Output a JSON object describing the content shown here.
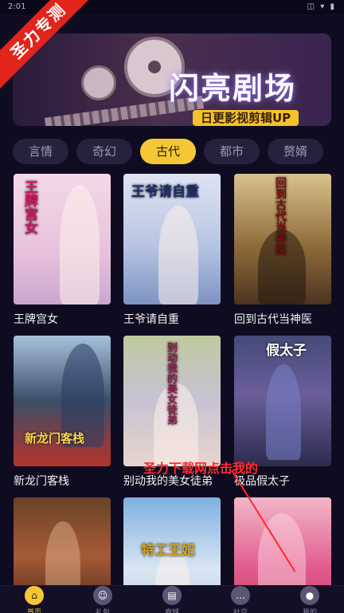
{
  "status_bar": {
    "time": "2:01",
    "icons": "◫ ▾ ▮"
  },
  "watermark": {
    "ribbon": "圣力专测",
    "overlay": "圣力下载网点击我的"
  },
  "banner": {
    "title": "闪亮剧场",
    "subtitle": "日更影视剪辑UP"
  },
  "tabs": [
    {
      "label": "言情",
      "active": false
    },
    {
      "label": "奇幻",
      "active": false
    },
    {
      "label": "古代",
      "active": true
    },
    {
      "label": "都市",
      "active": false
    },
    {
      "label": "赘婿",
      "active": false
    }
  ],
  "dramas": [
    {
      "title": "王牌宫女",
      "poster_text": "王牌宫女"
    },
    {
      "title": "王爷请自重",
      "poster_text": "王爷请自重"
    },
    {
      "title": "回到古代当神医",
      "poster_text": "回到古代当神医"
    },
    {
      "title": "新龙门客栈",
      "poster_text": "新龙门客栈"
    },
    {
      "title": "别动我的美女徒弟",
      "poster_text": "别动我的美女徒弟"
    },
    {
      "title": "极品假太子",
      "poster_text": "假太子"
    },
    {
      "title": "",
      "poster_text": ""
    },
    {
      "title": "",
      "poster_text": "特工王妃"
    },
    {
      "title": "",
      "poster_text": ""
    }
  ],
  "bottom_nav": [
    {
      "label": "首页",
      "icon": "home-icon",
      "glyph": "⌂",
      "active": true
    },
    {
      "label": "礼包",
      "icon": "gift-icon",
      "glyph": "☺",
      "active": false
    },
    {
      "label": "商城",
      "icon": "store-icon",
      "glyph": "▤",
      "active": false
    },
    {
      "label": "社交",
      "icon": "chat-icon",
      "glyph": "…",
      "active": false
    },
    {
      "label": "我的",
      "icon": "user-icon",
      "glyph": "●",
      "active": false
    }
  ]
}
